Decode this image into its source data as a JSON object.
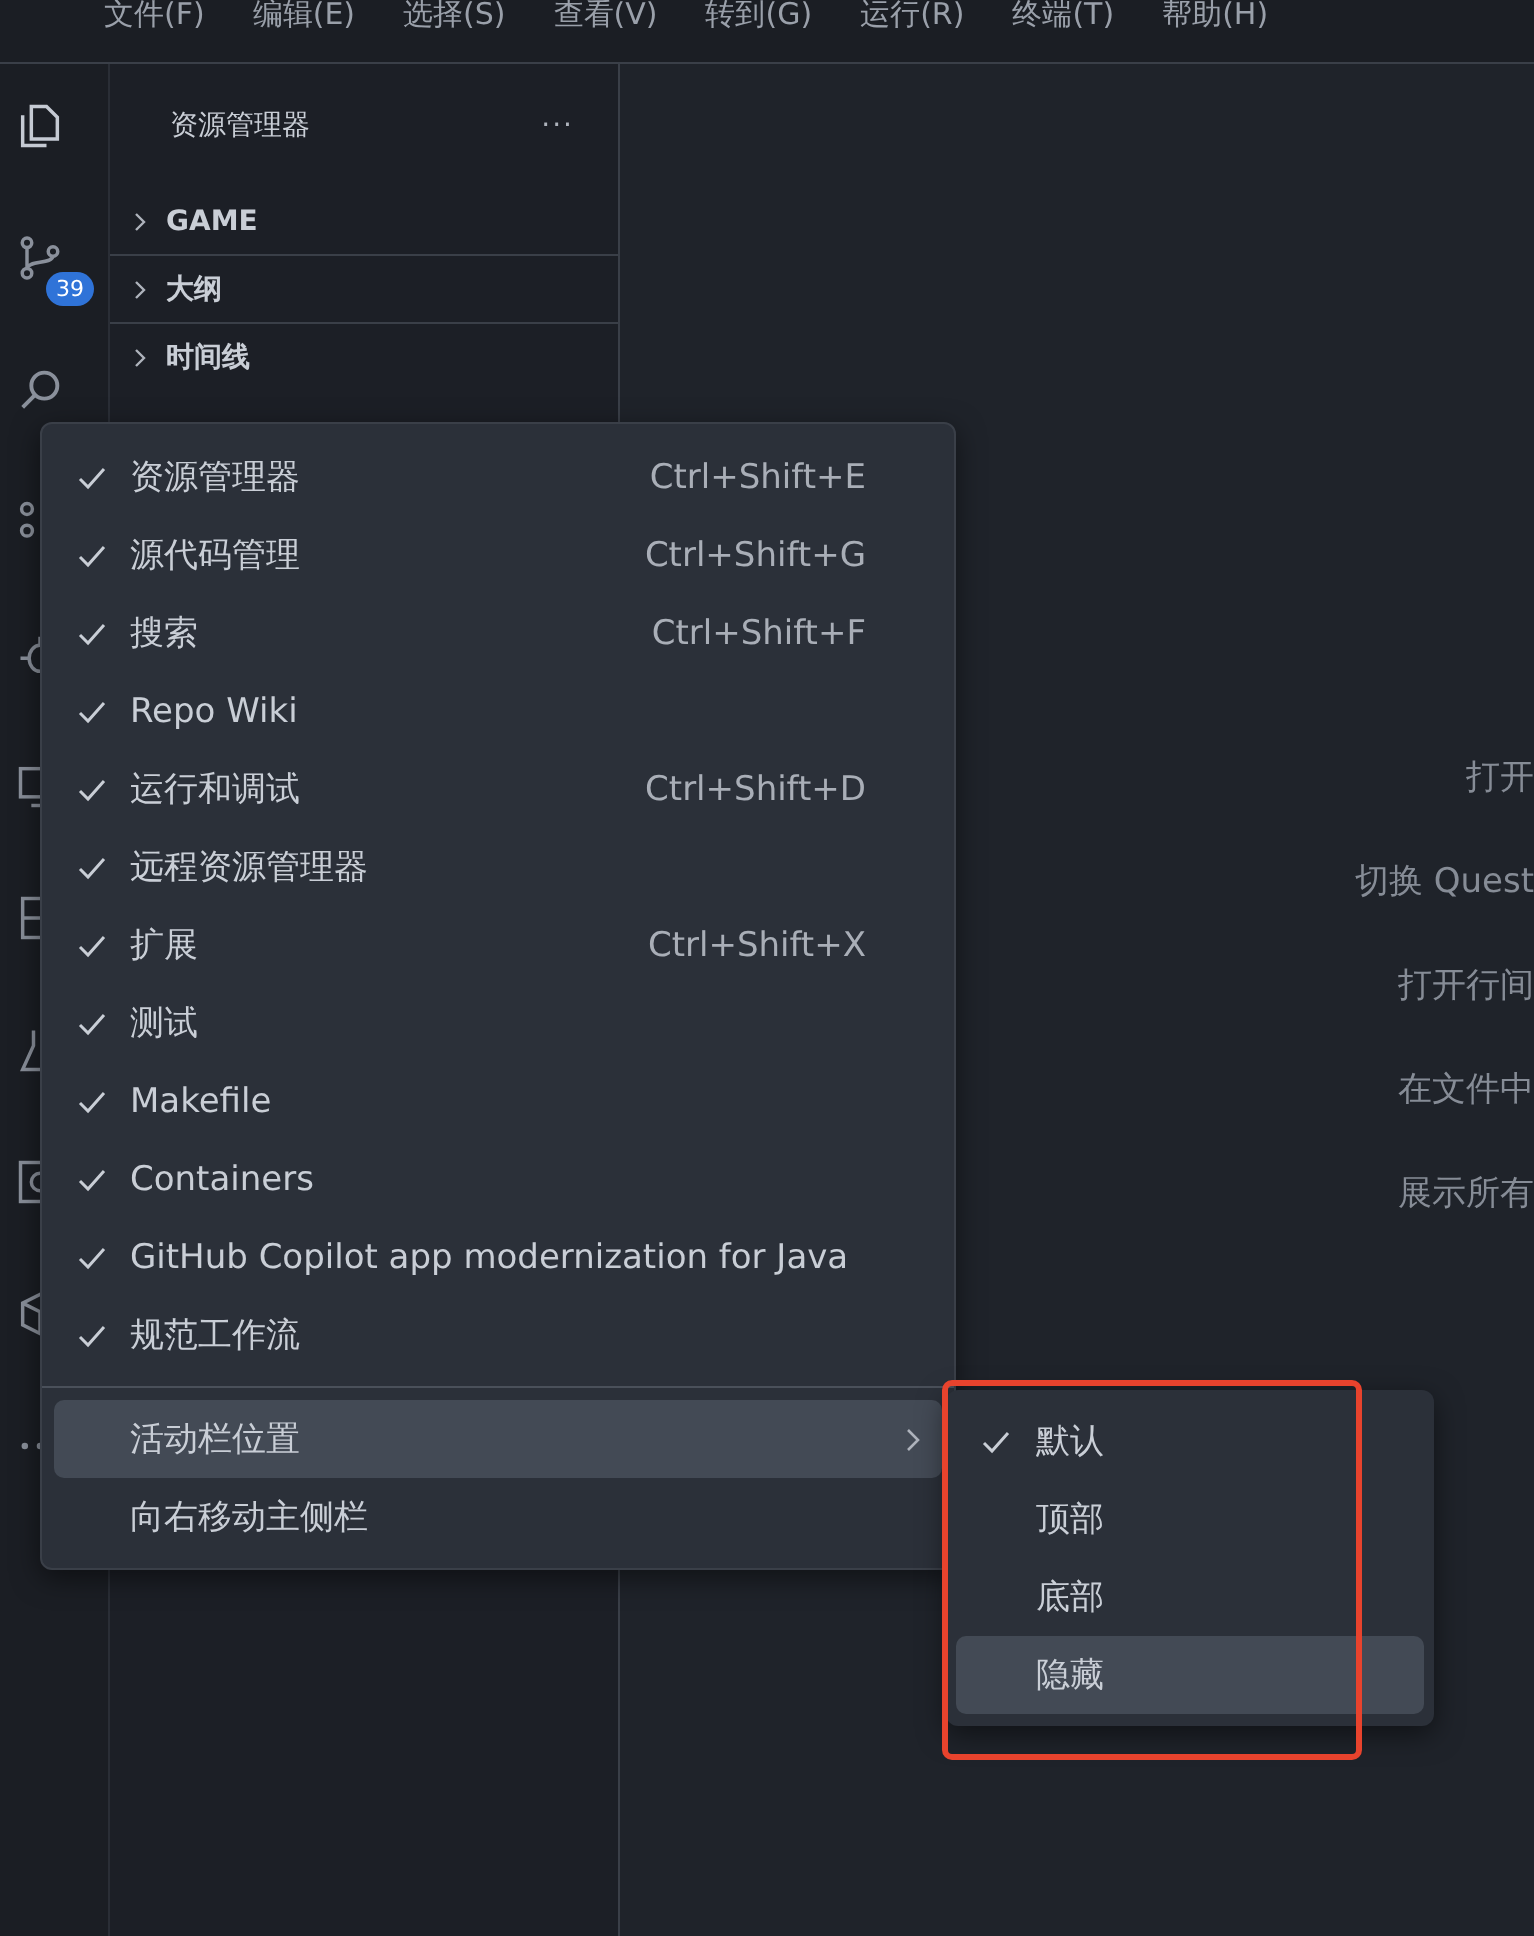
{
  "menu_bar": [
    "文件(F)",
    "编辑(E)",
    "选择(S)",
    "查看(V)",
    "转到(G)",
    "运行(R)",
    "终端(T)",
    "帮助(H)"
  ],
  "activity_bar": {
    "badge": "39"
  },
  "sidebar": {
    "title": "资源管理器",
    "more": "···",
    "sections": [
      {
        "label": "GAME",
        "expanded": false
      },
      {
        "label": "大纲",
        "expanded": false
      },
      {
        "label": "时间线",
        "expanded": false
      }
    ]
  },
  "editor_hints": [
    "打开",
    "切换 Quest",
    "打开行间",
    "在文件中",
    "展示所有"
  ],
  "context_menu": {
    "items": [
      {
        "label": "资源管理器",
        "checked": true,
        "shortcut": "Ctrl+Shift+E"
      },
      {
        "label": "源代码管理",
        "checked": true,
        "shortcut": "Ctrl+Shift+G"
      },
      {
        "label": "搜索",
        "checked": true,
        "shortcut": "Ctrl+Shift+F"
      },
      {
        "label": "Repo Wiki",
        "checked": true
      },
      {
        "label": "运行和调试",
        "checked": true,
        "shortcut": "Ctrl+Shift+D"
      },
      {
        "label": "远程资源管理器",
        "checked": true
      },
      {
        "label": "扩展",
        "checked": true,
        "shortcut": "Ctrl+Shift+X"
      },
      {
        "label": "测试",
        "checked": true
      },
      {
        "label": "Makefile",
        "checked": true
      },
      {
        "label": "Containers",
        "checked": true
      },
      {
        "label": "GitHub Copilot app modernization for Java",
        "checked": true
      },
      {
        "label": "规范工作流",
        "checked": true
      }
    ],
    "actions": [
      {
        "label": "活动栏位置",
        "kind": "submenu",
        "selected": true
      },
      {
        "label": "向右移动主侧栏",
        "kind": "action",
        "selected": false
      }
    ]
  },
  "submenu": {
    "items": [
      {
        "label": "默认",
        "checked": true,
        "selected": false
      },
      {
        "label": "顶部",
        "checked": false,
        "selected": false
      },
      {
        "label": "底部",
        "checked": false,
        "selected": false
      },
      {
        "label": "隐藏",
        "checked": false,
        "selected": true
      }
    ]
  }
}
